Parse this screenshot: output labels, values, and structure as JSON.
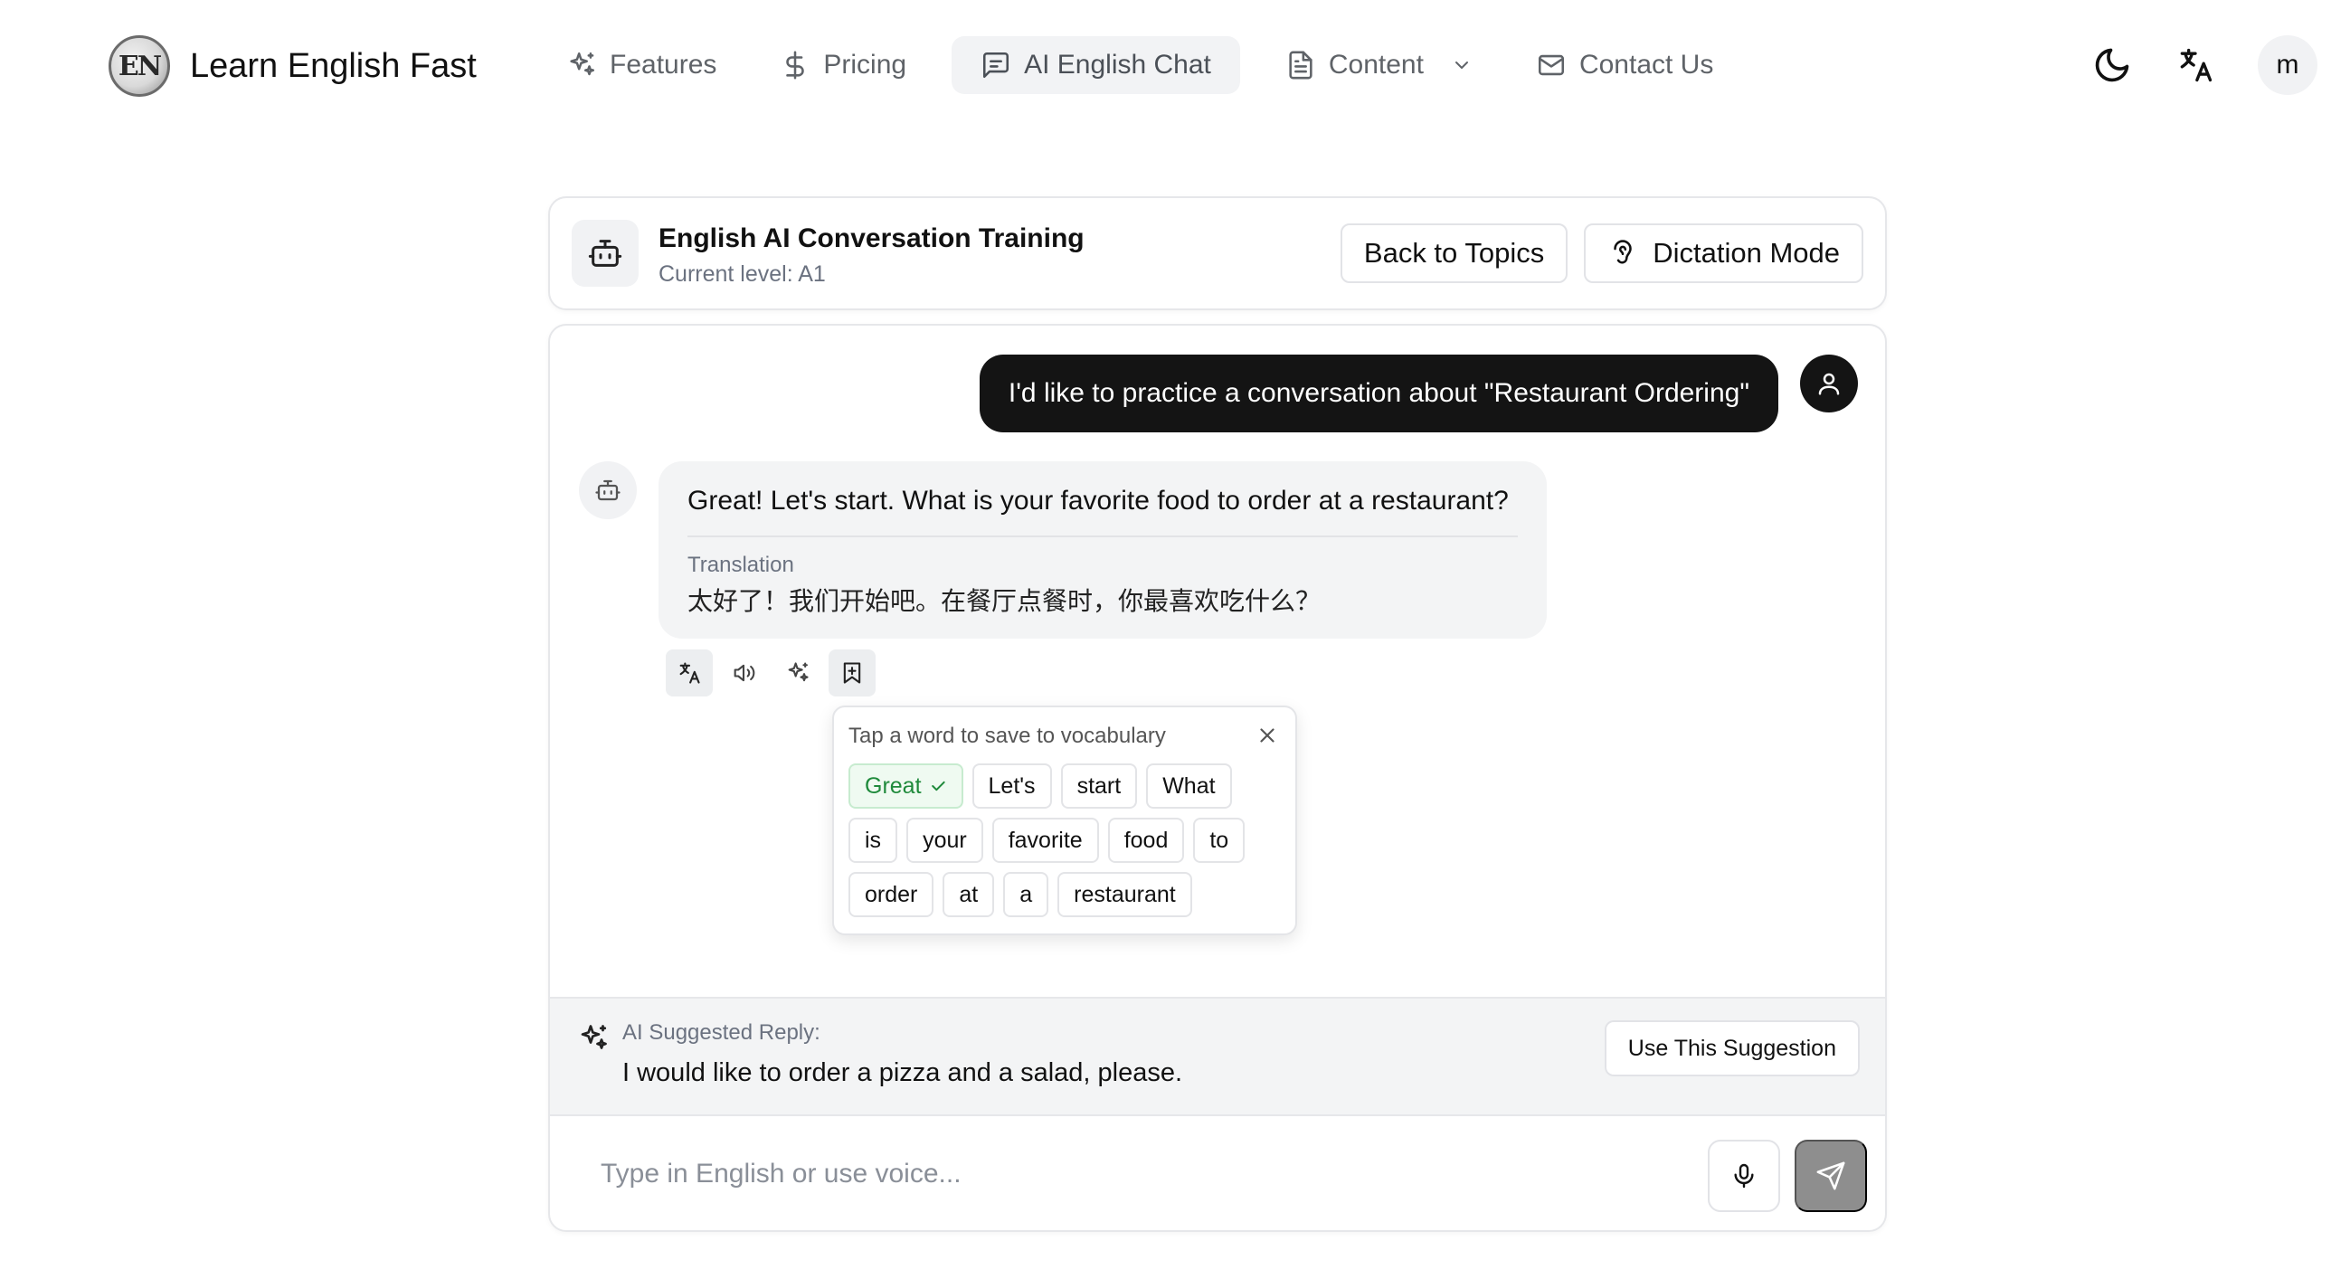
{
  "brand": {
    "logo_text": "EN",
    "name": "Learn English Fast"
  },
  "nav": {
    "items": [
      {
        "label": "Features",
        "icon": "sparkles-icon"
      },
      {
        "label": "Pricing",
        "icon": "dollar-icon"
      },
      {
        "label": "AI English Chat",
        "icon": "message-square-icon",
        "active": true
      },
      {
        "label": "Content",
        "icon": "file-text-icon",
        "has_dropdown": true
      },
      {
        "label": "Contact Us",
        "icon": "mail-icon"
      }
    ],
    "theme_toggle_icon": "moon-icon",
    "language_icon": "translate-icon",
    "avatar_initial": "m"
  },
  "session": {
    "title": "English AI Conversation Training",
    "level": "Current level: A1",
    "back_label": "Back to Topics",
    "dictation_label": "Dictation Mode"
  },
  "chat": {
    "user_message": "I'd like to practice a conversation about \"Restaurant Ordering\"",
    "ai_message": "Great! Let's start. What is your favorite food to order at a restaurant?",
    "translation_label": "Translation",
    "translation_text": "太好了！我们开始吧。在餐厅点餐时，你最喜欢吃什么？",
    "tools": [
      "translate-icon",
      "speaker-icon",
      "sparkles-icon",
      "bookmark-plus-icon"
    ]
  },
  "vocab": {
    "hint": "Tap a word to save to vocabulary",
    "words": [
      {
        "text": "Great",
        "saved": true
      },
      {
        "text": "Let's"
      },
      {
        "text": "start"
      },
      {
        "text": "What"
      },
      {
        "text": "is"
      },
      {
        "text": "your"
      },
      {
        "text": "favorite"
      },
      {
        "text": "food"
      },
      {
        "text": "to"
      },
      {
        "text": "order"
      },
      {
        "text": "at"
      },
      {
        "text": "a"
      },
      {
        "text": "restaurant"
      }
    ]
  },
  "suggestion": {
    "label": "AI Suggested Reply:",
    "text": "I would like to order a pizza and a salad, please.",
    "button": "Use This Suggestion"
  },
  "composer": {
    "placeholder": "Type in English or use voice..."
  },
  "colors": {
    "accent_dark": "#141414",
    "saved_green": "#1f8a3b",
    "send_disabled": "#8e8e8e"
  }
}
